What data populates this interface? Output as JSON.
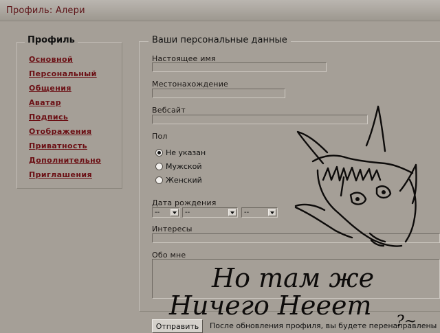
{
  "window": {
    "title": "Профиль: Алери"
  },
  "profile_nav": {
    "heading": "Профиль",
    "items": [
      {
        "label": "Основной"
      },
      {
        "label": "Персональный"
      },
      {
        "label": "Общения"
      },
      {
        "label": "Аватар"
      },
      {
        "label": "Подпись"
      },
      {
        "label": "Отображения"
      },
      {
        "label": "Приватность"
      },
      {
        "label": "Дополнительно"
      },
      {
        "label": "Приглашения"
      }
    ]
  },
  "form": {
    "legend": "Ваши персональные данные",
    "real_name": {
      "label": "Настоящее имя",
      "value": ""
    },
    "location": {
      "label": "Местонахождение",
      "value": ""
    },
    "website": {
      "label": "Вебсайт",
      "value": ""
    },
    "gender": {
      "label": "Пол",
      "options": [
        "Не указан",
        "Мужской",
        "Женский"
      ],
      "selected": "Не указан"
    },
    "birthday": {
      "label": "Дата рождения",
      "day": "--",
      "month": "--",
      "year": "--"
    },
    "interests": {
      "label": "Интересы",
      "value": ""
    },
    "about": {
      "label": "Обо мне",
      "value": ""
    },
    "submit_label": "Отправить",
    "notice": "После обновления профиля, вы будете перенаправлены"
  },
  "overlay_doodle": {
    "handwritten_text": [
      "Но там же",
      "Ничего Нееет",
      "?~"
    ]
  },
  "colors": {
    "page_bg": "#a59f97",
    "title_text": "#5e1418",
    "link_text": "#6b0f14"
  }
}
